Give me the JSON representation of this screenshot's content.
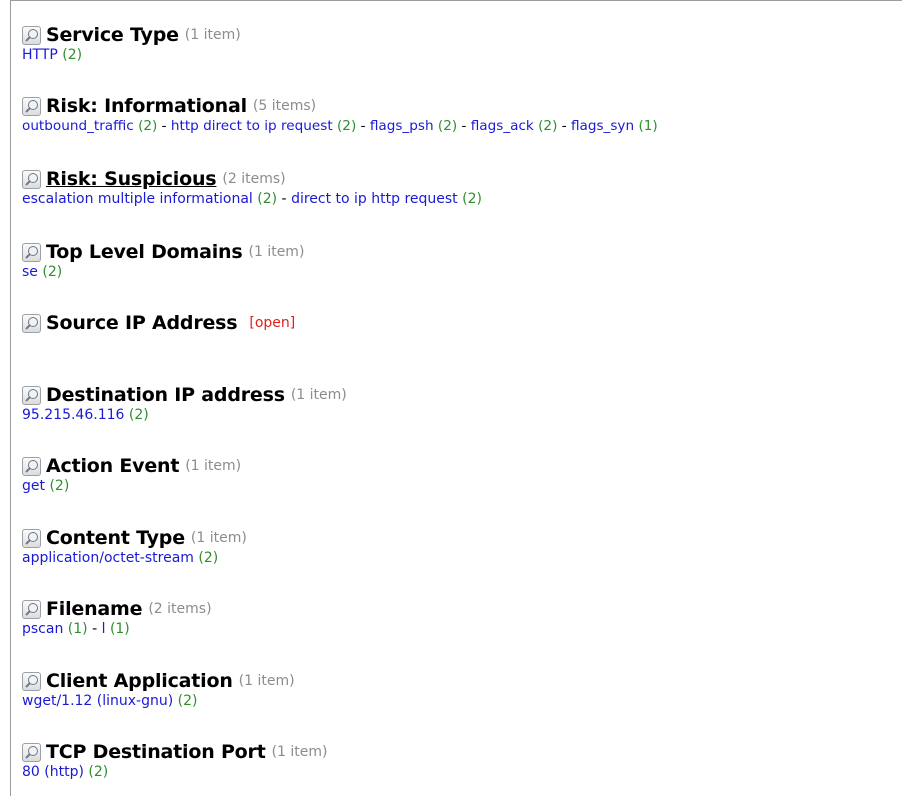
{
  "sections": [
    {
      "title": "Service Type",
      "count": "(1 item)",
      "values": [
        {
          "label": "HTTP",
          "count": "(2)"
        }
      ]
    },
    {
      "title": "Risk: Informational",
      "count": "(5 items)",
      "values": [
        {
          "label": "outbound_traffic",
          "count": "(2)"
        },
        {
          "label": "http direct to ip request",
          "count": "(2)"
        },
        {
          "label": "flags_psh",
          "count": "(2)"
        },
        {
          "label": "flags_ack",
          "count": "(2)"
        },
        {
          "label": "flags_syn",
          "count": "(1)"
        }
      ]
    },
    {
      "title": "Risk: Suspicious",
      "count": "(2 items)",
      "values": [
        {
          "label": "escalation multiple informational",
          "count": "(2)"
        },
        {
          "label": "direct to ip http request",
          "count": "(2)"
        }
      ]
    },
    {
      "title": "Top Level Domains",
      "count": "(1 item)",
      "values": [
        {
          "label": "se",
          "count": "(2)"
        }
      ]
    },
    {
      "title": "Source IP Address",
      "open_label": "[open]"
    },
    {
      "title": "Destination IP address",
      "count": "(1 item)",
      "values": [
        {
          "label": "95.215.46.116",
          "count": "(2)"
        }
      ]
    },
    {
      "title": "Action Event",
      "count": "(1 item)",
      "values": [
        {
          "label": "get",
          "count": "(2)"
        }
      ]
    },
    {
      "title": "Content Type",
      "count": "(1 item)",
      "values": [
        {
          "label": "application/octet-stream",
          "count": "(2)"
        }
      ]
    },
    {
      "title": "Filename",
      "count": "(2 items)",
      "values": [
        {
          "label": "pscan",
          "count": "(1)"
        },
        {
          "label": "l",
          "count": "(1)"
        }
      ]
    },
    {
      "title": "Client Application",
      "count": "(1 item)",
      "values": [
        {
          "label": "wget/1.12 (linux-gnu)",
          "count": "(2)"
        }
      ]
    },
    {
      "title": "TCP Destination Port",
      "count": "(1 item)",
      "values": [
        {
          "label": "80 (http)",
          "count": "(2)"
        }
      ]
    }
  ],
  "separator": " - ",
  "icon": "magnifier-icon",
  "colors": {
    "value_link": "#1a1ad6",
    "value_count": "#2e8f2e",
    "item_count": "#8c8c8c",
    "open_link": "#e02020"
  }
}
